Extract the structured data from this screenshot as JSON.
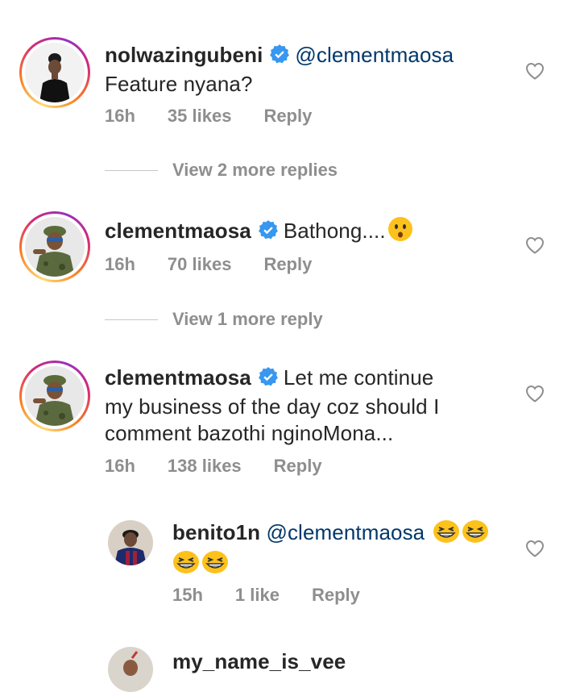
{
  "comments": [
    {
      "username": "nolwazingubeni",
      "verified": true,
      "mention": "@clementmaosa",
      "text": "Feature nyana?",
      "time": "16h",
      "likes": "35 likes",
      "reply": "Reply",
      "more_replies": "View 2 more replies",
      "avatar_icon": "avatar-woman"
    },
    {
      "username": "clementmaosa",
      "verified": true,
      "text": "Bathong....",
      "text_emoji": "hushed-face-emoji",
      "time": "16h",
      "likes": "70 likes",
      "reply": "Reply",
      "more_replies": "View 1 more reply",
      "avatar_icon": "avatar-man-camo"
    },
    {
      "username": "clementmaosa",
      "verified": true,
      "text_line1": "Let me continue",
      "text_line2": "my business of the day coz should I",
      "text_line3": "comment bazothi nginoMona...",
      "time": "16h",
      "likes": "138 likes",
      "reply": "Reply",
      "avatar_icon": "avatar-man-camo"
    }
  ],
  "replies": [
    {
      "username": "benito1n",
      "mention": "@clementmaosa",
      "emojis": [
        "grinning-squinting-face-emoji",
        "grinning-squinting-face-emoji",
        "grinning-squinting-face-emoji",
        "grinning-squinting-face-emoji"
      ],
      "time": "15h",
      "likes": "1 like",
      "reply": "Reply",
      "avatar_icon": "avatar-man-jersey"
    },
    {
      "username": "my_name_is_vee",
      "avatar_icon": "avatar-partial"
    }
  ],
  "colors": {
    "text": "#262626",
    "mention": "#00376b",
    "meta": "#8e8e8e",
    "verified": "#3897f0"
  }
}
